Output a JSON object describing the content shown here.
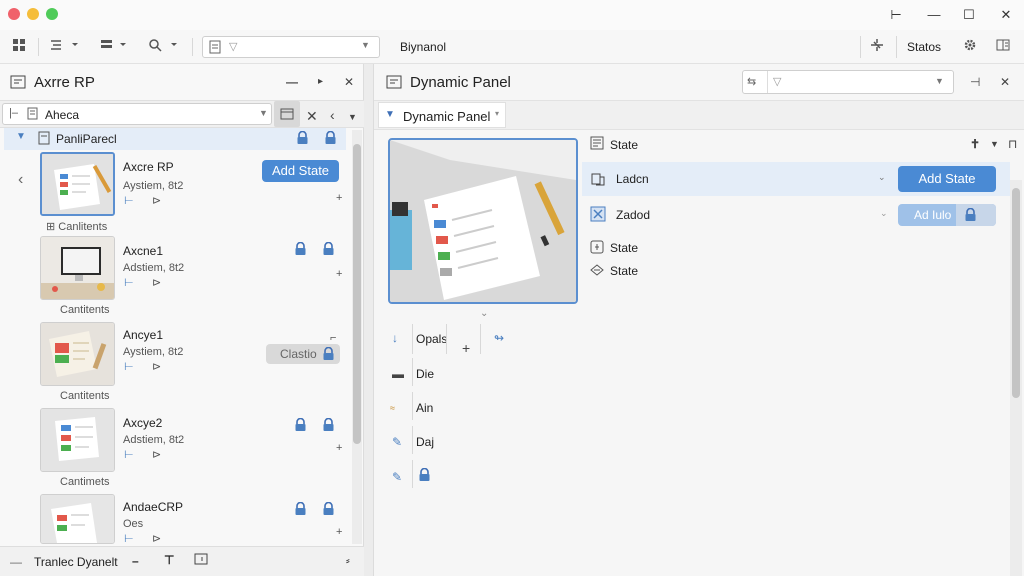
{
  "window": {
    "minimize": "⊢",
    "maximize": "—",
    "restore": "☐",
    "close": "✕"
  },
  "toolbar": {
    "search_value": "",
    "center_label": "Biynanol",
    "status_label": "Statos"
  },
  "left": {
    "title": "Axrre RP",
    "search_value": "Aheca",
    "group_label": "PanliParecl",
    "add_state": "Add State",
    "items": [
      {
        "name": "Axcre RP",
        "sub": "Aystiem, 8t2",
        "caption": "Canlitents"
      },
      {
        "name": "Axcne1",
        "sub": "Adstiem, 8t2",
        "caption": "Cantitents"
      },
      {
        "name": "Ancye1",
        "sub": "Aystiem, 8t2",
        "caption": "Cantitents",
        "chip": "Clastio"
      },
      {
        "name": "Axcye2",
        "sub": "Adstiem, 8t2",
        "caption": "Cantimets"
      },
      {
        "name": "AndaeCRP",
        "sub": "Oes",
        "caption": ""
      }
    ],
    "footer_label": "Tranlec Dyanelt"
  },
  "right": {
    "title": "Dynamic Panel",
    "tab_label": "Dynamic Panel",
    "state_header": "State",
    "states": [
      {
        "label": "Ladcn",
        "button": "Add State"
      },
      {
        "label": "Zadod",
        "button": "Ad Iulo"
      }
    ],
    "state_rows": [
      "State",
      "State"
    ],
    "props": [
      "Opals",
      "Die",
      "Ain",
      "Daj"
    ]
  },
  "colors": {
    "accent": "#4a8ad4",
    "selection_bg": "#e4edf8"
  }
}
